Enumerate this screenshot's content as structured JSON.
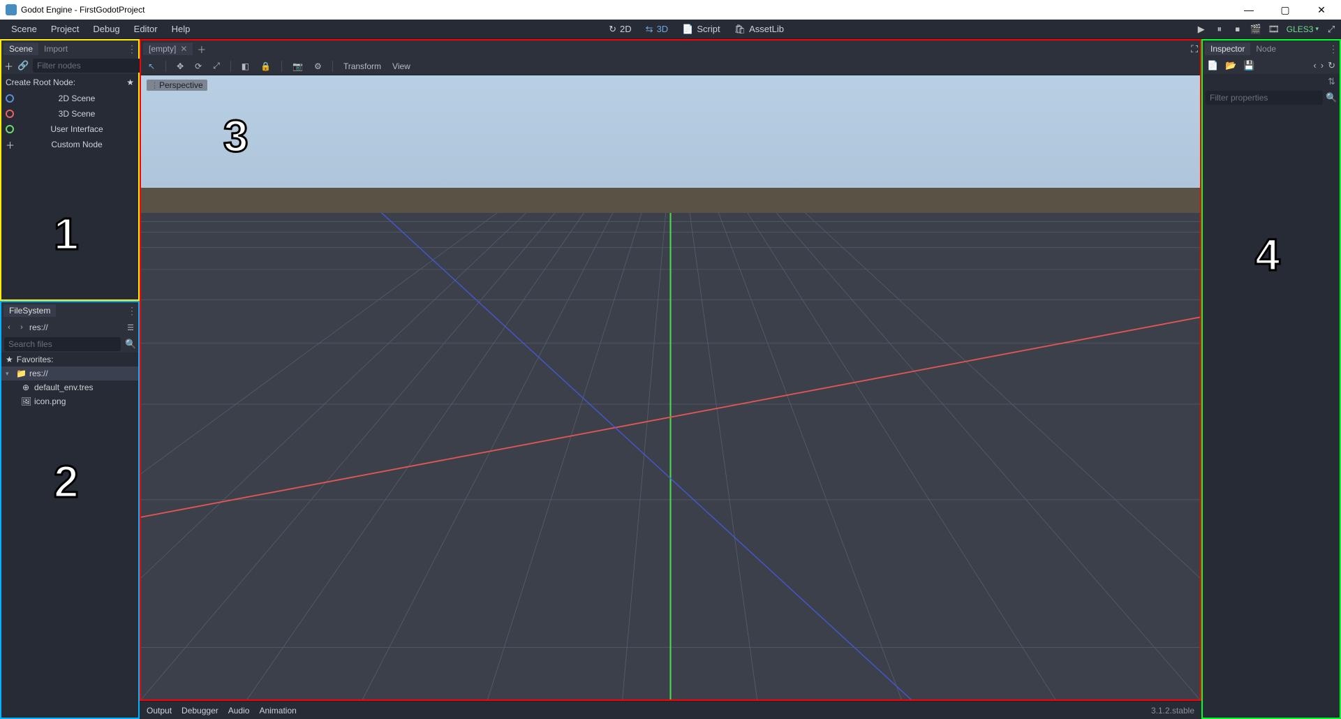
{
  "window": {
    "title": "Godot Engine - FirstGodotProject"
  },
  "menu": {
    "items": [
      "Scene",
      "Project",
      "Debug",
      "Editor",
      "Help"
    ]
  },
  "workspace": {
    "btn2d": "2D",
    "btn3d": "3D",
    "script": "Script",
    "assetlib": "AssetLib",
    "renderer": "GLES3"
  },
  "scene_panel": {
    "tab_scene": "Scene",
    "tab_import": "Import",
    "filter_placeholder": "Filter nodes",
    "create_root": "Create Root Node:",
    "opts": {
      "2d": "2D Scene",
      "3d": "3D Scene",
      "ui": "User Interface",
      "custom": "Custom Node"
    }
  },
  "filesystem": {
    "title": "FileSystem",
    "path": "res://",
    "search_placeholder": "Search files",
    "favorites": "Favorites:",
    "root": "res://",
    "files": {
      "env": "default_env.tres",
      "icon": "icon.png"
    }
  },
  "viewport": {
    "tab": "[empty]",
    "perspective": "Perspective",
    "transform": "Transform",
    "view": "View"
  },
  "inspector": {
    "tab_insp": "Inspector",
    "tab_node": "Node",
    "filter_placeholder": "Filter properties"
  },
  "bottom": {
    "output": "Output",
    "debugger": "Debugger",
    "audio": "Audio",
    "animation": "Animation",
    "version": "3.1.2.stable"
  },
  "annotations": {
    "n1": "1",
    "n2": "2",
    "n3": "3",
    "n4": "4"
  }
}
